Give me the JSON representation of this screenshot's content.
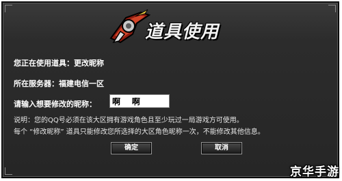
{
  "dialog": {
    "title": "道具使用",
    "item_line": "您正在使用道具：更改昵称",
    "server_line": "所在服务器：福建电信一区",
    "nickname_prompt": "请输入想要修改的昵称：",
    "nickname_value": "啊    啊",
    "note_line1": "说明：您的QQ号必须在该大区拥有游戏角色且至少玩过一局游戏方可使用。",
    "note_line2": "每个 “修改昵称” 道具只能修改您所选择的大区角色昵称一次，不能修改其他信息。",
    "ok_label": "确定",
    "cancel_label": "取消"
  },
  "watermark": {
    "text": "京华手游"
  },
  "colors": {
    "dialog_bg": "#2c2c2c",
    "text": "#ffffff",
    "emblem_red": "#c0301c"
  },
  "icons": {
    "emblem": "warrior-emblem-icon"
  }
}
